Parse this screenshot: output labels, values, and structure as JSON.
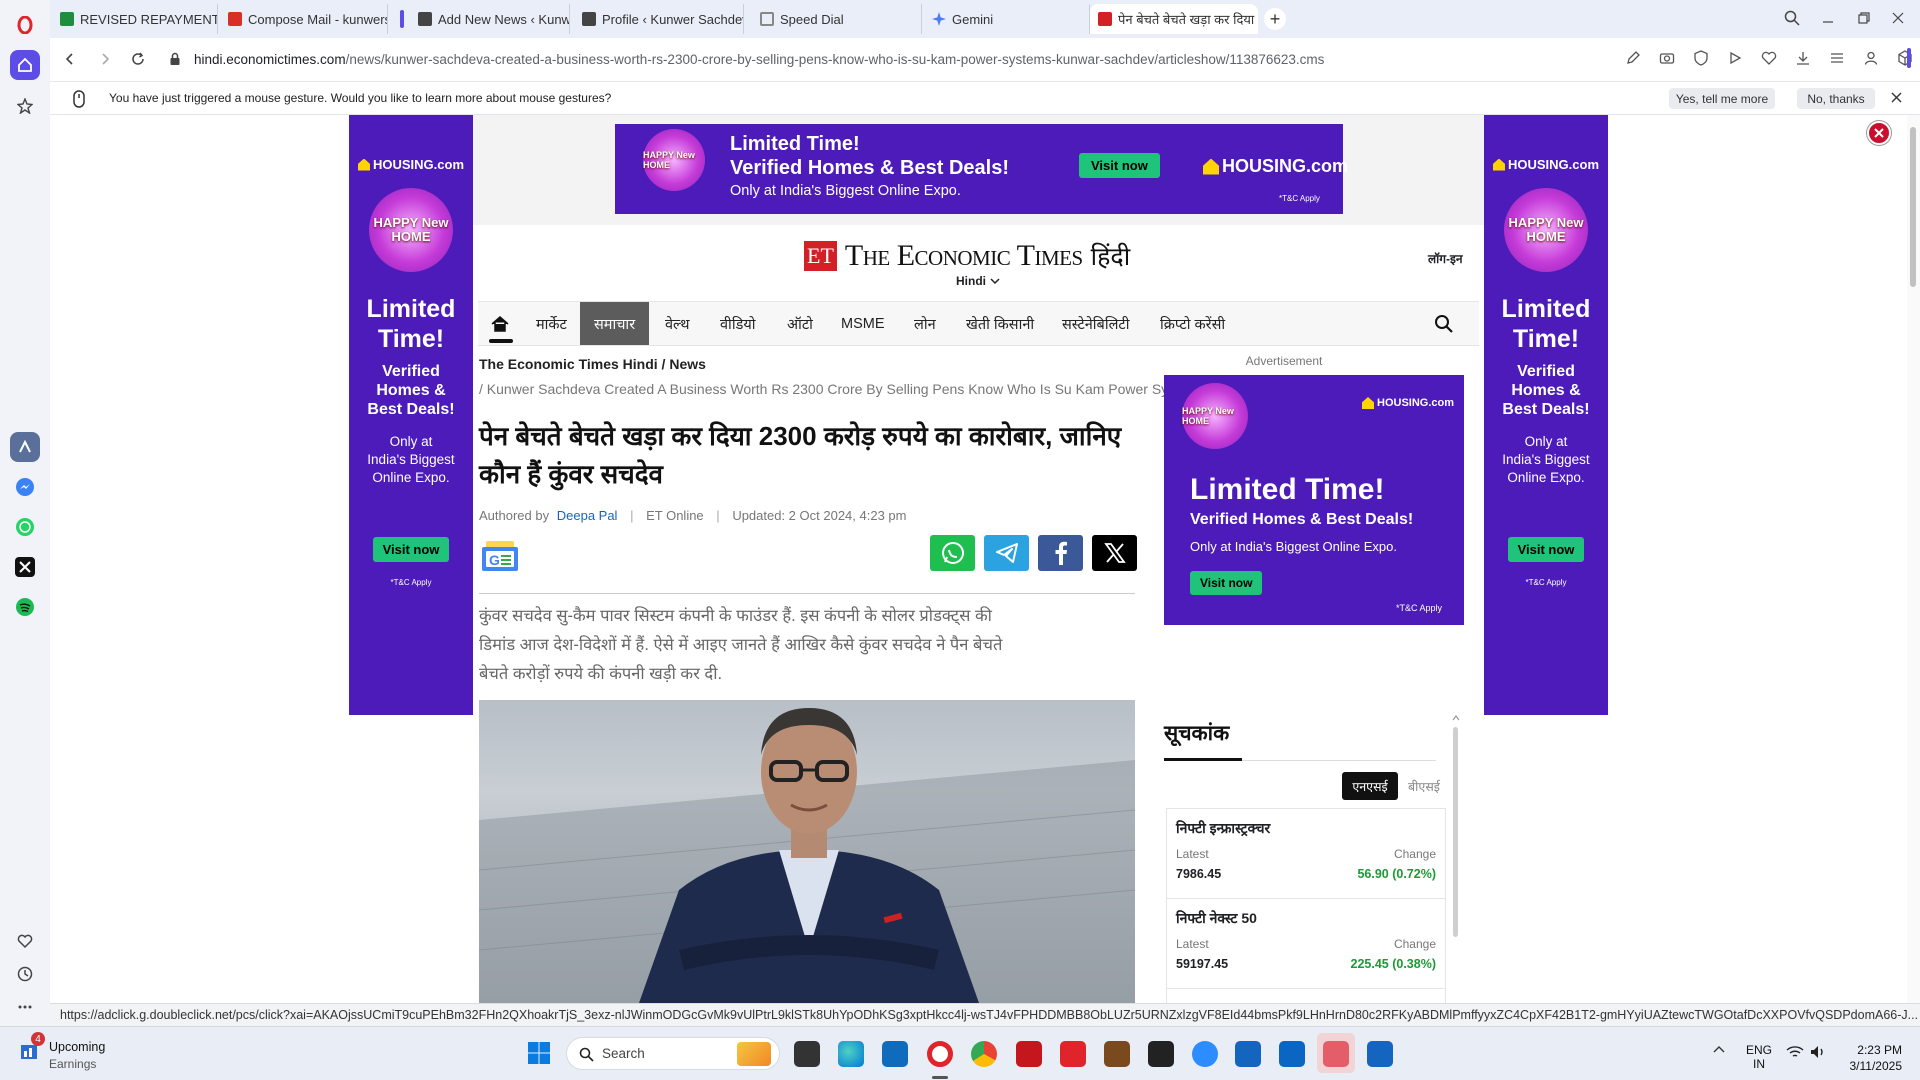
{
  "browser": {
    "tabs": [
      {
        "title": "REVISED REPAYMENT PLAN",
        "color": "#1e8e3e"
      },
      {
        "title": "Compose Mail - kunwersa",
        "color": "#d93025"
      },
      {
        "title": "Add New News ‹ Kunwer S",
        "color": "#444444"
      },
      {
        "title": "Profile ‹ Kunwer Sachdev",
        "color": "#444444"
      },
      {
        "title": "Speed Dial",
        "color": "#888888"
      },
      {
        "title": "Gemini",
        "color": "#4a7cf7"
      },
      {
        "title": "पेन बेचते बेचते खड़ा कर दिया",
        "color": "#d32027"
      }
    ],
    "url_domain": "hindi.economictimes.com",
    "url_path": "/news/kunwer-sachdeva-created-a-business-worth-rs-2300-crore-by-selling-pens-know-who-is-su-kam-power-systems-kunwar-sachdev/articleshow/113876623.cms",
    "notification": {
      "text": "You have just triggered a mouse gesture. Would you like to learn more about mouse gestures?",
      "yes": "Yes, tell me more",
      "no": "No, thanks"
    },
    "status_url": "https://adclick.g.doubleclick.net/pcs/click?xai=AKAOjssUCmiT9cuPEhBm32FHn2QXhoakrTjS_3exz-nlJWinmODGcGvMk9vUlPtrL9klSTk8UhYpODhKSg3xptHkcc4lj-wsTJ4vFPHDDMBB8ObLUZr5URNZxlzgVF8EId44bmsPkf9LHnHrnD80c2RFKyABDMlPmffyyxZC4CpXF42B1T2-gmHYyiUAZtewcTWGOtafDcXXPOVfvQSDPdomA66-J..."
  },
  "ads": {
    "brand": "HOUSING.com",
    "hnh": "HAPPY New HOME",
    "limited": "Limited Time!",
    "verified": "Verified Homes & Best Deals!",
    "expo": "Only at India's Biggest Online Expo.",
    "visit": "Visit now",
    "tc": "*T&C Apply",
    "advertisement": "Advertisement",
    "side_limited": [
      "Limited",
      "Time!"
    ],
    "side_verified": [
      "Verified",
      "Homes &",
      "Best Deals!"
    ],
    "side_expo": [
      "Only at",
      "India's Biggest",
      "Online Expo."
    ]
  },
  "site": {
    "logo_et": "ET",
    "logo_name": "The Economic Times",
    "logo_hindi": "हिंदी",
    "lang": "Hindi",
    "login": "लॉग-इन",
    "nav": [
      "मार्केट",
      "समाचार",
      "वेल्थ",
      "वीडियो",
      "ऑटो",
      "MSME",
      "लोन",
      "खेती किसानी",
      "सस्टेनेबिलिटी",
      "क्रिप्टो करेंसी"
    ]
  },
  "article": {
    "crumb1": "The Economic Times Hindi",
    "crumb2": "News",
    "crumb3": "/ Kunwer Sachdeva Created A Business Worth Rs 2300 Crore By Selling Pens Know Who Is Su Kam Power Systems Kunwar Sachdev",
    "headline1": "पेन बेचते बेचते खड़ा कर दिया 2300 करोड़ रुपये का कारोबार, जानिए",
    "headline2": "कौन हैं कुंवर सचदेव",
    "authored_by": "Authored by",
    "author": "Deepa Pal",
    "source": "ET Online",
    "updated": "Updated: 2 Oct 2024, 4:23 pm",
    "summary1": "कुंवर सचदेव सु-कैम पावर सिस्टम कंपनी के फाउंडर हैं. इस कंपनी के सोलर प्रोडक्ट्स की",
    "summary2": "डिमांड आज देश-विदेशों में हैं. ऐसे में आइए जानते हैं आखिर कैसे कुंवर सचदेव ने पैन बेचते",
    "summary3": "बेचते करोड़ों रुपये की कंपनी खड़ी कर दी."
  },
  "market": {
    "title": "सूचकांक",
    "tab_nse": "एनएसई",
    "tab_bse": "बीएसई",
    "latest": "Latest",
    "change": "Change",
    "rows": [
      {
        "name": "निफ्टी इन्फ्रास्ट्रक्चर",
        "value": "7986.45",
        "change": "56.90 (0.72%)"
      },
      {
        "name": "निफ्टी नेक्स्ट 50",
        "value": "59197.45",
        "change": "225.45 (0.38%)"
      }
    ]
  },
  "taskbar": {
    "badge": "4",
    "upcoming": "Upcoming",
    "earnings": "Earnings",
    "search": "Search",
    "lang1": "ENG",
    "lang2": "IN",
    "time": "2:23 PM",
    "date": "3/11/2025"
  }
}
